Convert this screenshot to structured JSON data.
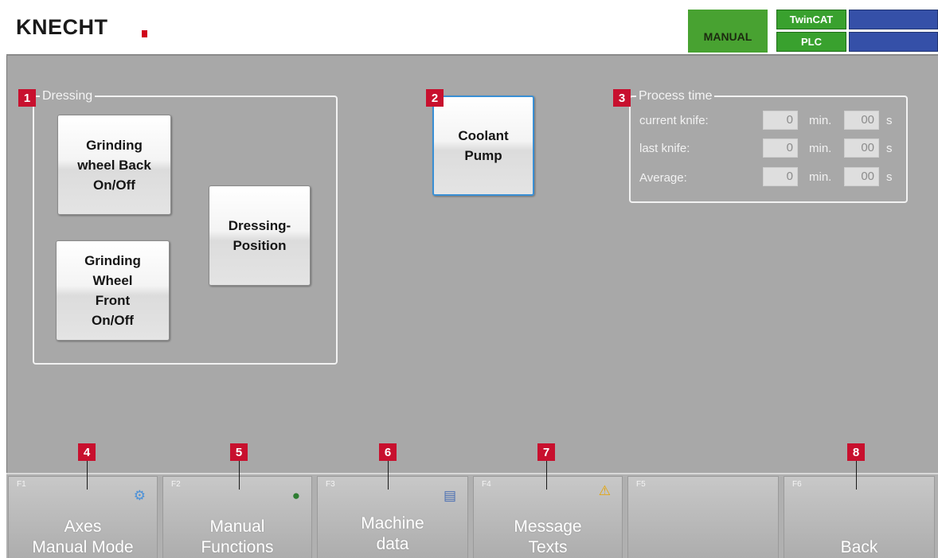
{
  "header": {
    "logo": "KNECHT",
    "mode": "MANUAL",
    "twincat": "TwinCAT",
    "plc": "PLC"
  },
  "markers": [
    "1",
    "2",
    "3",
    "4",
    "5",
    "6",
    "7",
    "8"
  ],
  "dressing": {
    "title": "Dressing",
    "grinding_back": "Grinding\nwheel Back\nOn/Off",
    "grinding_front": "Grinding\nWheel\nFront\nOn/Off",
    "dressing_position": "Dressing-\nPosition"
  },
  "coolant": {
    "label": "Coolant\nPump"
  },
  "process_time": {
    "title": "Process time",
    "rows": [
      {
        "label": "current knife:",
        "minutes": "0",
        "min_unit": "min.",
        "seconds": "00",
        "sec_unit": "s"
      },
      {
        "label": "last knife:",
        "minutes": "0",
        "min_unit": "min.",
        "seconds": "00",
        "sec_unit": "s"
      },
      {
        "label": "Average:",
        "minutes": "0",
        "min_unit": "min.",
        "seconds": "00",
        "sec_unit": "s"
      }
    ]
  },
  "function_keys": [
    {
      "key": "F1",
      "label": "Axes\nManual Mode",
      "icon": "gear-icon"
    },
    {
      "key": "F2",
      "label": "Manual\nFunctions",
      "icon": "person-icon"
    },
    {
      "key": "F3",
      "label": "Machine\ndata",
      "icon": "document-icon"
    },
    {
      "key": "F4",
      "label": "Message\nTexts",
      "icon": "warning-icon"
    },
    {
      "key": "F5",
      "label": "",
      "icon": ""
    },
    {
      "key": "F6",
      "label": "Back",
      "icon": ""
    }
  ],
  "colors": {
    "mode_green": "#48a231",
    "status_green": "#39a12e",
    "status_blue": "#3550a8",
    "marker_red": "#c8102e",
    "active_border": "#3a8fd4"
  }
}
